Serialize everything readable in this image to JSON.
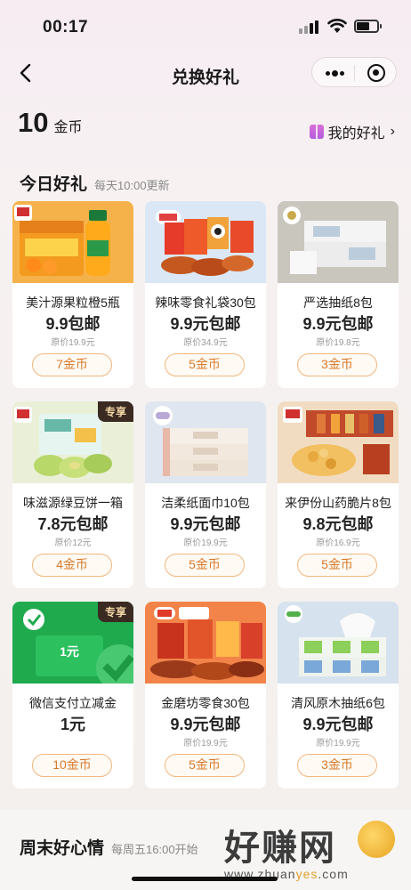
{
  "status_bar": {
    "time": "00:17"
  },
  "nav": {
    "title": "兑换好礼"
  },
  "wallet": {
    "coins": "10",
    "unit": "金币",
    "my_gifts": "我的好礼"
  },
  "today_section": {
    "title": "今日好礼",
    "subtitle": "每天10:00更新"
  },
  "weekend_section": {
    "title": "周末好心情",
    "subtitle": "每周五16:00开始"
  },
  "products": [
    {
      "name": "美汁源果粒橙5瓶",
      "price": "9.9包邮",
      "original": "原价19.9元",
      "cost": "7金币",
      "tag": "",
      "img": "orange"
    },
    {
      "name": "辣味零食礼袋30包",
      "price": "9.9元包邮",
      "original": "原价34.9元",
      "cost": "5金币",
      "tag": "",
      "img": "snack"
    },
    {
      "name": "严选抽纸8包",
      "price": "9.9元包邮",
      "original": "原价19.8元",
      "cost": "3金币",
      "tag": "",
      "img": "tissue"
    },
    {
      "name": "味滋源绿豆饼一箱",
      "price": "7.8元包邮",
      "original": "原价12元",
      "cost": "4金币",
      "tag": "专享",
      "img": "cake"
    },
    {
      "name": "洁柔纸面巾10包",
      "price": "9.9元包邮",
      "original": "原价19.9元",
      "cost": "5金币",
      "tag": "",
      "img": "face"
    },
    {
      "name": "来伊份山药脆片8包",
      "price": "9.8元包邮",
      "original": "原价16.9元",
      "cost": "5金币",
      "tag": "",
      "img": "chips"
    },
    {
      "name": "微信支付立减金",
      "price": "1元",
      "original": "",
      "cost": "10金币",
      "tag": "专享",
      "img": "wechat"
    },
    {
      "name": "金磨坊零食30包",
      "price": "9.9元包邮",
      "original": "原价19.9元",
      "cost": "5金币",
      "tag": "",
      "img": "snack2"
    },
    {
      "name": "清风原木抽纸6包",
      "price": "9.9元包邮",
      "original": "原价19.9元",
      "cost": "3金币",
      "tag": "",
      "img": "tissue2"
    }
  ],
  "wechat_card_amount": "1元",
  "watermark": {
    "text": "好赚网",
    "url_prefix": "www.zhuan",
    "url_accent": "yes",
    "url_suffix": ".com"
  }
}
